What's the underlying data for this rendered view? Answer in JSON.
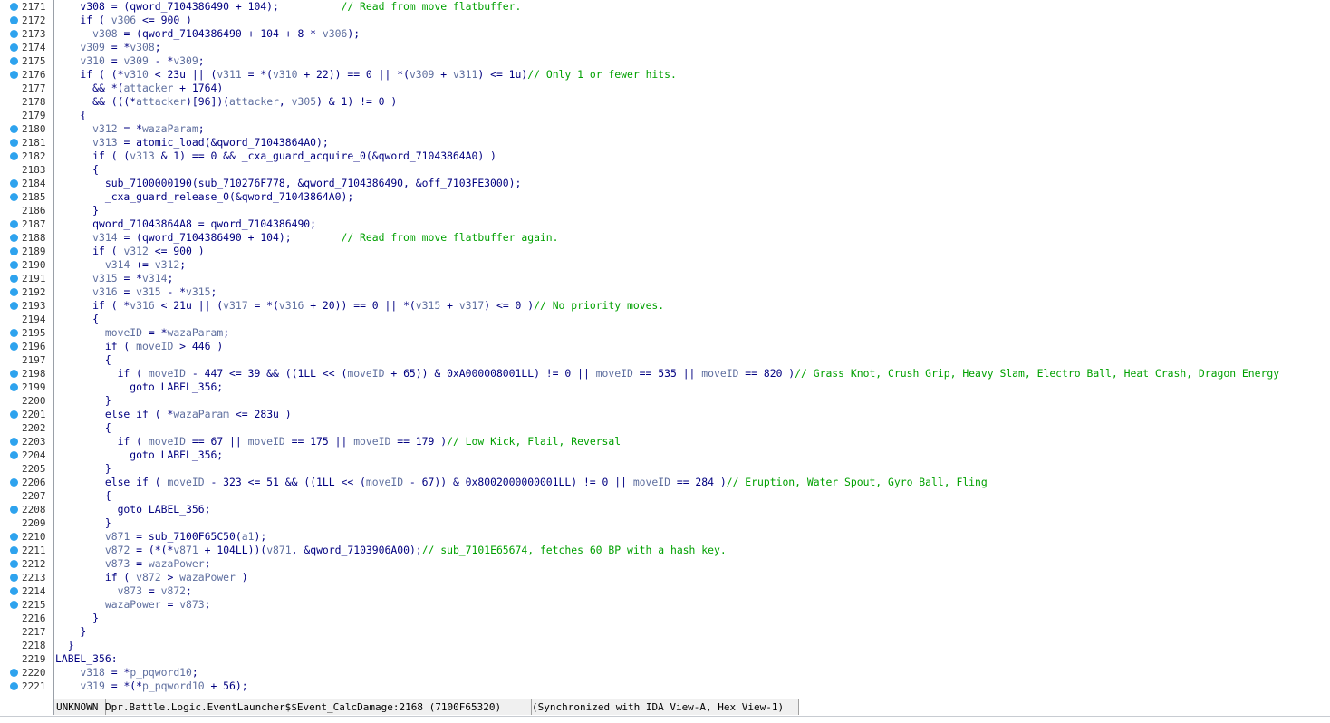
{
  "colors": {
    "keyword_text": "#000080",
    "variable_text": "#5f6f9f",
    "comment_text": "#00a000",
    "breakpoint_dot": "#2ea3ee",
    "status_bg": "#f0f0f0"
  },
  "code_lines": [
    {
      "num": "2171",
      "bp": true,
      "segs": [
        [
          "c",
          "    v308 = (qword_7104386490 + 104);          "
        ],
        [
          "m",
          "// Read from move flatbuffer."
        ]
      ]
    },
    {
      "num": "2172",
      "bp": true,
      "segs": [
        [
          "c",
          "    if ( "
        ],
        [
          "v",
          "v306"
        ],
        [
          "c",
          " <= 900 )"
        ]
      ]
    },
    {
      "num": "2173",
      "bp": true,
      "segs": [
        [
          "c",
          "      "
        ],
        [
          "v",
          "v308"
        ],
        [
          "c",
          " = (qword_7104386490 + 104 + 8 * "
        ],
        [
          "v",
          "v306"
        ],
        [
          "c",
          ");"
        ]
      ]
    },
    {
      "num": "2174",
      "bp": true,
      "segs": [
        [
          "c",
          "    "
        ],
        [
          "v",
          "v309"
        ],
        [
          "c",
          " = *"
        ],
        [
          "v",
          "v308"
        ],
        [
          "c",
          ";"
        ]
      ]
    },
    {
      "num": "2175",
      "bp": true,
      "segs": [
        [
          "c",
          "    "
        ],
        [
          "v",
          "v310"
        ],
        [
          "c",
          " = "
        ],
        [
          "v",
          "v309"
        ],
        [
          "c",
          " - *"
        ],
        [
          "v",
          "v309"
        ],
        [
          "c",
          ";"
        ]
      ]
    },
    {
      "num": "2176",
      "bp": true,
      "segs": [
        [
          "c",
          "    if ( (*"
        ],
        [
          "v",
          "v310"
        ],
        [
          "c",
          " < 23u || ("
        ],
        [
          "v",
          "v311"
        ],
        [
          "c",
          " = *("
        ],
        [
          "v",
          "v310"
        ],
        [
          "c",
          " + 22)) == 0 || *("
        ],
        [
          "v",
          "v309"
        ],
        [
          "c",
          " + "
        ],
        [
          "v",
          "v311"
        ],
        [
          "c",
          ") <= 1u)"
        ],
        [
          "m",
          "// Only 1 or fewer hits."
        ]
      ]
    },
    {
      "num": "2177",
      "bp": false,
      "segs": [
        [
          "c",
          "      && *("
        ],
        [
          "v",
          "attacker"
        ],
        [
          "c",
          " + 1764)"
        ]
      ]
    },
    {
      "num": "2178",
      "bp": false,
      "segs": [
        [
          "c",
          "      && (((*"
        ],
        [
          "v",
          "attacker"
        ],
        [
          "c",
          ")[96])("
        ],
        [
          "v",
          "attacker"
        ],
        [
          "c",
          ", "
        ],
        [
          "v",
          "v305"
        ],
        [
          "c",
          ") & 1) != 0 )"
        ]
      ]
    },
    {
      "num": "2179",
      "bp": false,
      "segs": [
        [
          "c",
          "    {"
        ]
      ]
    },
    {
      "num": "2180",
      "bp": true,
      "segs": [
        [
          "c",
          "      "
        ],
        [
          "v",
          "v312"
        ],
        [
          "c",
          " = *"
        ],
        [
          "v",
          "wazaParam"
        ],
        [
          "c",
          ";"
        ]
      ]
    },
    {
      "num": "2181",
      "bp": true,
      "segs": [
        [
          "c",
          "      "
        ],
        [
          "v",
          "v313"
        ],
        [
          "c",
          " = atomic_load(&qword_71043864A0);"
        ]
      ]
    },
    {
      "num": "2182",
      "bp": true,
      "segs": [
        [
          "c",
          "      if ( ("
        ],
        [
          "v",
          "v313"
        ],
        [
          "c",
          " & 1) == 0 && _cxa_guard_acquire_0(&qword_71043864A0) )"
        ]
      ]
    },
    {
      "num": "2183",
      "bp": false,
      "segs": [
        [
          "c",
          "      {"
        ]
      ]
    },
    {
      "num": "2184",
      "bp": true,
      "segs": [
        [
          "c",
          "        sub_7100000190(sub_710276F778, &qword_7104386490, &off_7103FE3000);"
        ]
      ]
    },
    {
      "num": "2185",
      "bp": true,
      "segs": [
        [
          "c",
          "        _cxa_guard_release_0(&qword_71043864A0);"
        ]
      ]
    },
    {
      "num": "2186",
      "bp": false,
      "segs": [
        [
          "c",
          "      }"
        ]
      ]
    },
    {
      "num": "2187",
      "bp": true,
      "segs": [
        [
          "c",
          "      qword_71043864A8 = qword_7104386490;"
        ]
      ]
    },
    {
      "num": "2188",
      "bp": true,
      "segs": [
        [
          "c",
          "      "
        ],
        [
          "v",
          "v314"
        ],
        [
          "c",
          " = (qword_7104386490 + 104);        "
        ],
        [
          "m",
          "// Read from move flatbuffer again."
        ]
      ]
    },
    {
      "num": "2189",
      "bp": true,
      "segs": [
        [
          "c",
          "      if ( "
        ],
        [
          "v",
          "v312"
        ],
        [
          "c",
          " <= 900 )"
        ]
      ]
    },
    {
      "num": "2190",
      "bp": true,
      "segs": [
        [
          "c",
          "        "
        ],
        [
          "v",
          "v314"
        ],
        [
          "c",
          " += "
        ],
        [
          "v",
          "v312"
        ],
        [
          "c",
          ";"
        ]
      ]
    },
    {
      "num": "2191",
      "bp": true,
      "segs": [
        [
          "c",
          "      "
        ],
        [
          "v",
          "v315"
        ],
        [
          "c",
          " = *"
        ],
        [
          "v",
          "v314"
        ],
        [
          "c",
          ";"
        ]
      ]
    },
    {
      "num": "2192",
      "bp": true,
      "segs": [
        [
          "c",
          "      "
        ],
        [
          "v",
          "v316"
        ],
        [
          "c",
          " = "
        ],
        [
          "v",
          "v315"
        ],
        [
          "c",
          " - *"
        ],
        [
          "v",
          "v315"
        ],
        [
          "c",
          ";"
        ]
      ]
    },
    {
      "num": "2193",
      "bp": true,
      "segs": [
        [
          "c",
          "      if ( *"
        ],
        [
          "v",
          "v316"
        ],
        [
          "c",
          " < 21u || ("
        ],
        [
          "v",
          "v317"
        ],
        [
          "c",
          " = *("
        ],
        [
          "v",
          "v316"
        ],
        [
          "c",
          " + 20)) == 0 || *("
        ],
        [
          "v",
          "v315"
        ],
        [
          "c",
          " + "
        ],
        [
          "v",
          "v317"
        ],
        [
          "c",
          ") <= 0 )"
        ],
        [
          "m",
          "// No priority moves."
        ]
      ]
    },
    {
      "num": "2194",
      "bp": false,
      "segs": [
        [
          "c",
          "      {"
        ]
      ]
    },
    {
      "num": "2195",
      "bp": true,
      "segs": [
        [
          "c",
          "        "
        ],
        [
          "v",
          "moveID"
        ],
        [
          "c",
          " = *"
        ],
        [
          "v",
          "wazaParam"
        ],
        [
          "c",
          ";"
        ]
      ]
    },
    {
      "num": "2196",
      "bp": true,
      "segs": [
        [
          "c",
          "        if ( "
        ],
        [
          "v",
          "moveID"
        ],
        [
          "c",
          " > 446 )"
        ]
      ]
    },
    {
      "num": "2197",
      "bp": false,
      "segs": [
        [
          "c",
          "        {"
        ]
      ]
    },
    {
      "num": "2198",
      "bp": true,
      "segs": [
        [
          "c",
          "          if ( "
        ],
        [
          "v",
          "moveID"
        ],
        [
          "c",
          " - 447 <= 39 && ((1LL << ("
        ],
        [
          "v",
          "moveID"
        ],
        [
          "c",
          " + 65)) & 0xA000008001LL) != 0 || "
        ],
        [
          "v",
          "moveID"
        ],
        [
          "c",
          " == 535 || "
        ],
        [
          "v",
          "moveID"
        ],
        [
          "c",
          " == 820 )"
        ],
        [
          "m",
          "// Grass Knot, Crush Grip, Heavy Slam, Electro Ball, Heat Crash, Dragon Energy"
        ]
      ]
    },
    {
      "num": "2199",
      "bp": true,
      "segs": [
        [
          "c",
          "            goto LABEL_356;"
        ]
      ]
    },
    {
      "num": "2200",
      "bp": false,
      "segs": [
        [
          "c",
          "        }"
        ]
      ]
    },
    {
      "num": "2201",
      "bp": true,
      "segs": [
        [
          "c",
          "        else if ( *"
        ],
        [
          "v",
          "wazaParam"
        ],
        [
          "c",
          " <= 283u )"
        ]
      ]
    },
    {
      "num": "2202",
      "bp": false,
      "segs": [
        [
          "c",
          "        {"
        ]
      ]
    },
    {
      "num": "2203",
      "bp": true,
      "segs": [
        [
          "c",
          "          if ( "
        ],
        [
          "v",
          "moveID"
        ],
        [
          "c",
          " == 67 || "
        ],
        [
          "v",
          "moveID"
        ],
        [
          "c",
          " == 175 || "
        ],
        [
          "v",
          "moveID"
        ],
        [
          "c",
          " == 179 )"
        ],
        [
          "m",
          "// Low Kick, Flail, Reversal"
        ]
      ]
    },
    {
      "num": "2204",
      "bp": true,
      "segs": [
        [
          "c",
          "            goto LABEL_356;"
        ]
      ]
    },
    {
      "num": "2205",
      "bp": false,
      "segs": [
        [
          "c",
          "        }"
        ]
      ]
    },
    {
      "num": "2206",
      "bp": true,
      "segs": [
        [
          "c",
          "        else if ( "
        ],
        [
          "v",
          "moveID"
        ],
        [
          "c",
          " - 323 <= 51 && ((1LL << ("
        ],
        [
          "v",
          "moveID"
        ],
        [
          "c",
          " - 67)) & 0x8002000000001LL) != 0 || "
        ],
        [
          "v",
          "moveID"
        ],
        [
          "c",
          " == 284 )"
        ],
        [
          "m",
          "// Eruption, Water Spout, Gyro Ball, Fling"
        ]
      ]
    },
    {
      "num": "2207",
      "bp": false,
      "segs": [
        [
          "c",
          "        {"
        ]
      ]
    },
    {
      "num": "2208",
      "bp": true,
      "segs": [
        [
          "c",
          "          goto LABEL_356;"
        ]
      ]
    },
    {
      "num": "2209",
      "bp": false,
      "segs": [
        [
          "c",
          "        }"
        ]
      ]
    },
    {
      "num": "2210",
      "bp": true,
      "segs": [
        [
          "c",
          "        "
        ],
        [
          "v",
          "v871"
        ],
        [
          "c",
          " = sub_7100F65C50("
        ],
        [
          "v",
          "a1"
        ],
        [
          "c",
          ");"
        ]
      ]
    },
    {
      "num": "2211",
      "bp": true,
      "segs": [
        [
          "c",
          "        "
        ],
        [
          "v",
          "v872"
        ],
        [
          "c",
          " = (*(*"
        ],
        [
          "v",
          "v871"
        ],
        [
          "c",
          " + 104LL))("
        ],
        [
          "v",
          "v871"
        ],
        [
          "c",
          ", &qword_7103906A00);"
        ],
        [
          "m",
          "// sub_7101E65674, fetches 60 BP with a hash key."
        ]
      ]
    },
    {
      "num": "2212",
      "bp": true,
      "segs": [
        [
          "c",
          "        "
        ],
        [
          "v",
          "v873"
        ],
        [
          "c",
          " = "
        ],
        [
          "v",
          "wazaPower"
        ],
        [
          "c",
          ";"
        ]
      ]
    },
    {
      "num": "2213",
      "bp": true,
      "segs": [
        [
          "c",
          "        if ( "
        ],
        [
          "v",
          "v872"
        ],
        [
          "c",
          " > "
        ],
        [
          "v",
          "wazaPower"
        ],
        [
          "c",
          " )"
        ]
      ]
    },
    {
      "num": "2214",
      "bp": true,
      "segs": [
        [
          "c",
          "          "
        ],
        [
          "v",
          "v873"
        ],
        [
          "c",
          " = "
        ],
        [
          "v",
          "v872"
        ],
        [
          "c",
          ";"
        ]
      ]
    },
    {
      "num": "2215",
      "bp": true,
      "segs": [
        [
          "c",
          "        "
        ],
        [
          "v",
          "wazaPower"
        ],
        [
          "c",
          " = "
        ],
        [
          "v",
          "v873"
        ],
        [
          "c",
          ";"
        ]
      ]
    },
    {
      "num": "2216",
      "bp": false,
      "segs": [
        [
          "c",
          "      }"
        ]
      ]
    },
    {
      "num": "2217",
      "bp": false,
      "segs": [
        [
          "c",
          "    }"
        ]
      ]
    },
    {
      "num": "2218",
      "bp": false,
      "segs": [
        [
          "c",
          "  }"
        ]
      ]
    },
    {
      "num": "2219",
      "bp": false,
      "segs": [
        [
          "c",
          "LABEL_356:"
        ]
      ]
    },
    {
      "num": "2220",
      "bp": true,
      "segs": [
        [
          "c",
          "    "
        ],
        [
          "v",
          "v318"
        ],
        [
          "c",
          " = *"
        ],
        [
          "v",
          "p_pqword10"
        ],
        [
          "c",
          ";"
        ]
      ]
    },
    {
      "num": "2221",
      "bp": true,
      "segs": [
        [
          "c",
          "    "
        ],
        [
          "v",
          "v319"
        ],
        [
          "c",
          " = *(*"
        ],
        [
          "v",
          "p_pqword10"
        ],
        [
          "c",
          " + 56);"
        ]
      ]
    }
  ],
  "status_bar": {
    "kind": "UNKNOWN",
    "location": "Dpr.Battle.Logic.EventLauncher$$Event_CalcDamage:2168 (7100F65320)",
    "sync": "(Synchronized with IDA View-A, Hex View-1)"
  }
}
